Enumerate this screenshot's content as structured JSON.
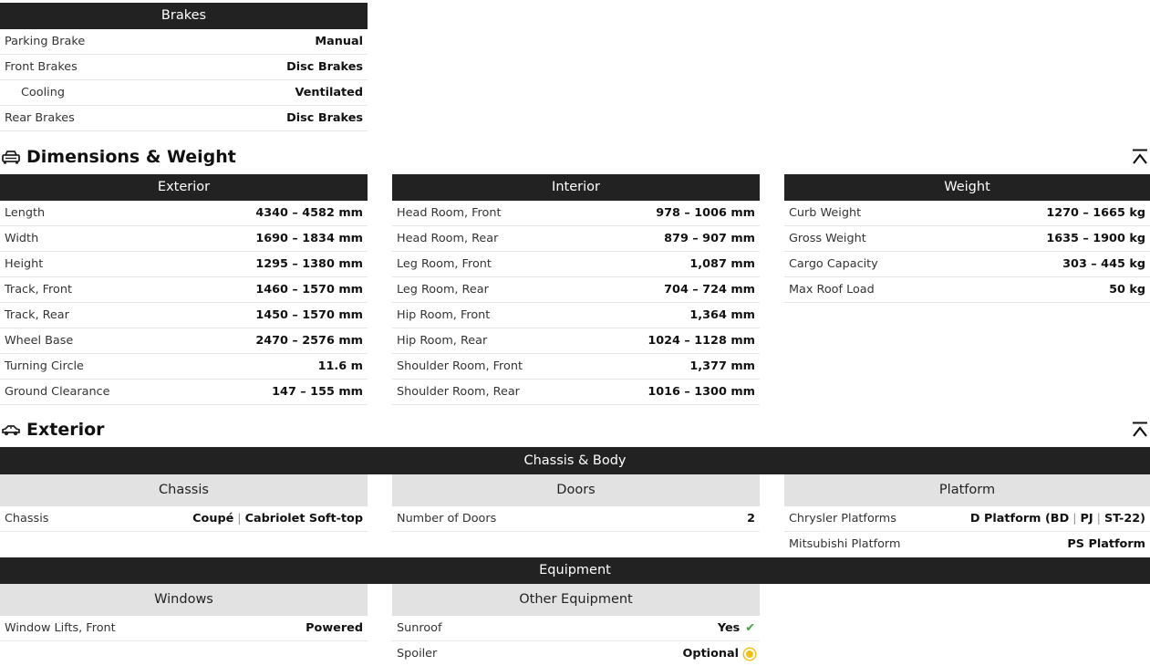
{
  "brakes": {
    "header": "Brakes",
    "rows": [
      {
        "label": "Parking Brake",
        "value": "Manual"
      },
      {
        "label": "Front Brakes",
        "value": "Disc Brakes"
      },
      {
        "label": "Cooling",
        "value": "Ventilated"
      },
      {
        "label": "Rear Brakes",
        "value": "Disc Brakes"
      }
    ]
  },
  "dimensions": {
    "title": "Dimensions & Weight",
    "exterior": {
      "header": "Exterior",
      "rows": [
        {
          "label": "Length",
          "value": "4340 – 4582 mm"
        },
        {
          "label": "Width",
          "value": "1690 – 1834 mm"
        },
        {
          "label": "Height",
          "value": "1295 – 1380 mm"
        },
        {
          "label": "Track, Front",
          "value": "1460 – 1570 mm"
        },
        {
          "label": "Track, Rear",
          "value": "1450 – 1570 mm"
        },
        {
          "label": "Wheel Base",
          "value": "2470 – 2576 mm"
        },
        {
          "label": "Turning Circle",
          "value": "11.6 m"
        },
        {
          "label": "Ground Clearance",
          "value": "147 – 155 mm"
        }
      ]
    },
    "interior": {
      "header": "Interior",
      "rows": [
        {
          "label": "Head Room, Front",
          "value": "978 – 1006 mm"
        },
        {
          "label": "Head Room, Rear",
          "value": "879 – 907 mm"
        },
        {
          "label": "Leg Room, Front",
          "value": "1,087 mm"
        },
        {
          "label": "Leg Room, Rear",
          "value": "704 – 724 mm"
        },
        {
          "label": "Hip Room, Front",
          "value": "1,364 mm"
        },
        {
          "label": "Hip Room, Rear",
          "value": "1024 – 1128 mm"
        },
        {
          "label": "Shoulder Room, Front",
          "value": "1,377 mm"
        },
        {
          "label": "Shoulder Room, Rear",
          "value": "1016 – 1300 mm"
        }
      ]
    },
    "weight": {
      "header": "Weight",
      "rows": [
        {
          "label": "Curb Weight",
          "value": "1270 – 1665 kg"
        },
        {
          "label": "Gross Weight",
          "value": "1635 – 1900 kg"
        },
        {
          "label": "Cargo Capacity",
          "value": "303 – 445 kg"
        },
        {
          "label": "Max Roof Load",
          "value": "50 kg"
        }
      ]
    }
  },
  "exterior": {
    "title": "Exterior",
    "chassis_body": {
      "header": "Chassis & Body",
      "chassis": {
        "header": "Chassis",
        "label": "Chassis",
        "values": [
          "Coupé",
          "Cabriolet Soft-top"
        ]
      },
      "doors": {
        "header": "Doors",
        "label": "Number of Doors",
        "value": "2"
      },
      "platform": {
        "header": "Platform",
        "chrysler_label": "Chrysler Platforms",
        "chrysler_values": [
          "D Platform (BD",
          "PJ",
          "ST-22)"
        ],
        "mitsubishi_label": "Mitsubishi Platform",
        "mitsubishi_value": "PS Platform"
      }
    },
    "equipment": {
      "header": "Equipment",
      "windows": {
        "header": "Windows",
        "label": "Window Lifts, Front",
        "value": "Powered"
      },
      "other": {
        "header": "Other Equipment",
        "sunroof_label": "Sunroof",
        "sunroof_value": "Yes",
        "spoiler_label": "Spoiler",
        "spoiler_value": "Optional"
      }
    }
  },
  "icons": {
    "dimensions_icon": "car-front-icon",
    "exterior_icon": "car-side-icon",
    "collapse_icon": "collapse-up-icon",
    "check_icon": "check-icon",
    "optional_icon": "optional-dot-icon"
  },
  "colors": {
    "header_bg": "#222222",
    "subheader_bg": "#e2e2e2",
    "check": "#3aa63a",
    "optional": "#f2c21b"
  }
}
